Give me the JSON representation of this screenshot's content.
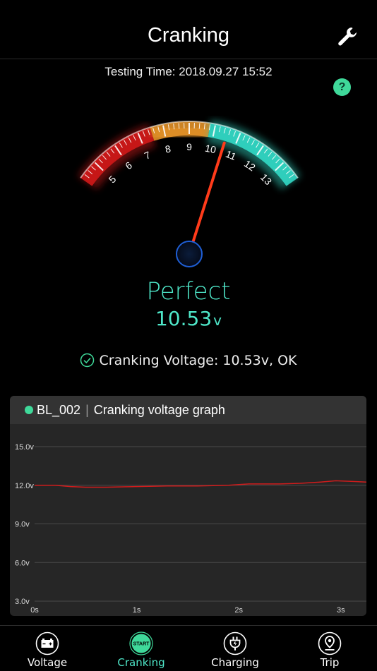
{
  "header": {
    "title": "Cranking",
    "settings_icon": "wrench-icon"
  },
  "testing_time": "Testing Time: 2018.09.27  15:52",
  "help_label": "?",
  "gauge": {
    "ticks": [
      "5",
      "6",
      "7",
      "8",
      "9",
      "10",
      "11",
      "12",
      "13"
    ],
    "value": 10.53,
    "min": 4.2,
    "max": 13.8,
    "zones": {
      "red": "#d81a1a",
      "orange": "#f09a2a",
      "cyan": "#34e0cc"
    }
  },
  "status": {
    "label": "Perfect",
    "value": "10.53",
    "unit": "v"
  },
  "result_text": "Cranking Voltage: 10.53v, OK",
  "graph": {
    "device": "BL_002",
    "separator": "|",
    "title": "Cranking voltage graph"
  },
  "chart_data": {
    "type": "line",
    "x_ticks": [
      "0s",
      "1s",
      "2s",
      "3s"
    ],
    "y_ticks": [
      "15.0v",
      "12.0v",
      "9.0v",
      "6.0v",
      "3.0v"
    ],
    "ylim": [
      3,
      15
    ],
    "xlim": [
      0,
      3.25
    ],
    "series": [
      {
        "color": "#d11c1c",
        "x": [
          0,
          0.2,
          0.35,
          0.5,
          0.7,
          1.0,
          1.3,
          1.6,
          1.9,
          2.0,
          2.1,
          2.2,
          2.4,
          2.6,
          2.8,
          2.95,
          3.1,
          3.25
        ],
        "y": [
          12.0,
          12.0,
          11.9,
          11.85,
          11.85,
          11.9,
          11.95,
          11.95,
          12.0,
          12.05,
          12.1,
          12.1,
          12.1,
          12.15,
          12.25,
          12.35,
          12.3,
          12.25
        ]
      }
    ]
  },
  "tabs": [
    {
      "label": "Voltage",
      "icon": "battery-icon",
      "active": false
    },
    {
      "label": "Cranking",
      "icon": "start-icon",
      "icon_text": "START",
      "active": true
    },
    {
      "label": "Charging",
      "icon": "plug-icon",
      "active": false
    },
    {
      "label": "Trip",
      "icon": "map-pin-icon",
      "active": false
    }
  ]
}
